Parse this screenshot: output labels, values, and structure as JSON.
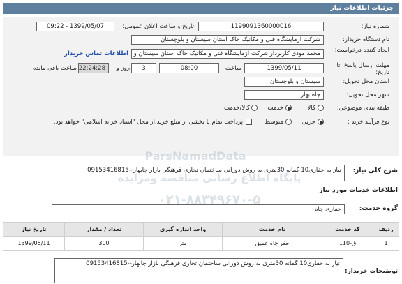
{
  "header": {
    "title": "جزئیات اطلاعات نیاز"
  },
  "need_number": {
    "label": "شماره نیاز:",
    "value": "1199091360000016"
  },
  "announce_date": {
    "label": "تاریخ و ساعت اعلان عمومی:",
    "value": "1399/05/07 - 09:22"
  },
  "buyer": {
    "label": "نام دستگاه خریدار:",
    "value": "شرکت آزمایشگاه فنی و مکانیک خاک استان سیستان و بلوچستان"
  },
  "creator": {
    "label": "ایجاد کننده درخواست:",
    "value": "محمد مودی کاربردار شرکت آزمایشگاه فنی و مکانیک خاک استان سیستان و بلوچستان",
    "link": "اطلاعات تماس خریدار"
  },
  "deadline": {
    "label": "مهلت ارسال پاسخ: تا تاریخ:",
    "date": "1399/05/11",
    "time_label": "ساعت",
    "time": "08:00",
    "days": "3",
    "days_label": "روز و",
    "remaining": "22:24:28",
    "remaining_label": "ساعت باقی مانده"
  },
  "delivery_province": {
    "label": "استان محل تحویل:",
    "value": "سیستان و بلوچستان"
  },
  "delivery_city": {
    "label": "شهر محل تحویل:",
    "value": "چاه بهار"
  },
  "category": {
    "label": "طبقه بندی موضوعی:",
    "options": [
      "کالا",
      "خدمت",
      "کالا/خدمت"
    ],
    "selected": "خدمت"
  },
  "process": {
    "label": "نوع فرآیند خرید :",
    "options": [
      "جزیی",
      "متوسط"
    ],
    "selected": "جزیی",
    "payment_note": "پرداخت تمام یا بخشی از مبلغ خرید،از محل \"اسناد خزانه اسلامی\" خواهد بود."
  },
  "summary": {
    "label": "شرح کلی نیاز:",
    "value": "نیاز به حفاری10 گمانه 30متری به روش دورانی ساختمان تجاری فرهنگی بازار چابهار--09153416815"
  },
  "services_info": {
    "title": "اطلاعات خدمات مورد نیاز"
  },
  "service_group": {
    "label": "گروه خدمت:",
    "value": "حفاری چاه"
  },
  "table": {
    "headers": [
      "ردیف",
      "کد خدمت",
      "نام خدمت",
      "واحد اندازه گیری",
      "تعداد / مقدار",
      "تاریخ نیاز"
    ],
    "rows": [
      [
        "1",
        "ق-110",
        "حفر چاه عمیق",
        "متر",
        "300",
        "1399/05/11"
      ]
    ]
  },
  "buyer_notes": {
    "label": "توضیحات خریدار:",
    "value": "نیاز به حفاری10 گمانه 30متری به روش دورانی ساختمان تجاری فرهنگی بازار چابهار--09153416815"
  },
  "watermark": {
    "line1": "پایگاه اطلاع رسانی مناقصه ومزایده",
    "line2": "۰۲۱-۸۸۳۴۹۶۷۰-۵",
    "line3": "ParsNamadData"
  },
  "colors": {
    "header_bg": "#5e7f9e",
    "panel_bg": "#f2f2f2",
    "link": "#1f4fa8"
  }
}
